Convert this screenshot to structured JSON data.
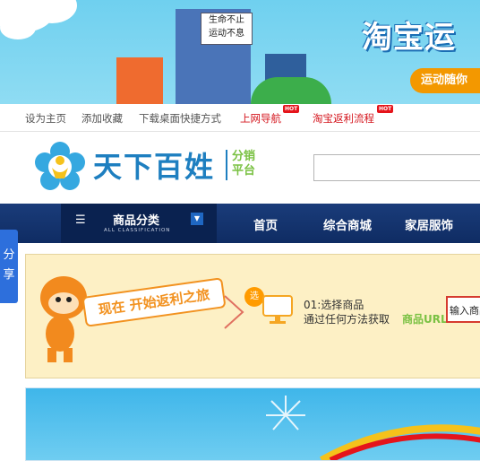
{
  "banner": {
    "sign_line1": "生命不止",
    "sign_line2": "运动不息",
    "title": "淘宝运",
    "subtitle": "运动随你"
  },
  "toplinks": {
    "items": [
      {
        "label": "设为主页"
      },
      {
        "label": "添加收藏"
      },
      {
        "label": "下载桌面快捷方式"
      },
      {
        "label": "上网导航",
        "badge": "HOT"
      },
      {
        "label": "淘宝返利流程",
        "badge": "HOT"
      }
    ]
  },
  "logo": {
    "name": "天下百姓",
    "sub_line1": "分销",
    "sub_line2": "平台"
  },
  "nav": {
    "category_label": "商品分类",
    "category_sub": "ALL CLASSIFICATION",
    "items": [
      "首页",
      "综合商城",
      "家居服饰"
    ]
  },
  "share": {
    "label": "分享"
  },
  "step": {
    "start_label": "现在 开始返利之旅",
    "badge": "选",
    "title": "01:选择商品",
    "description": "通过任何方法获取",
    "url_label": "商品URL",
    "input_value": "输入商品"
  },
  "colors": {
    "nav_bg": "#1a3c7a",
    "brand_blue": "#1e7fc0",
    "hot_red": "#e5141b",
    "accent_orange": "#f29220"
  }
}
